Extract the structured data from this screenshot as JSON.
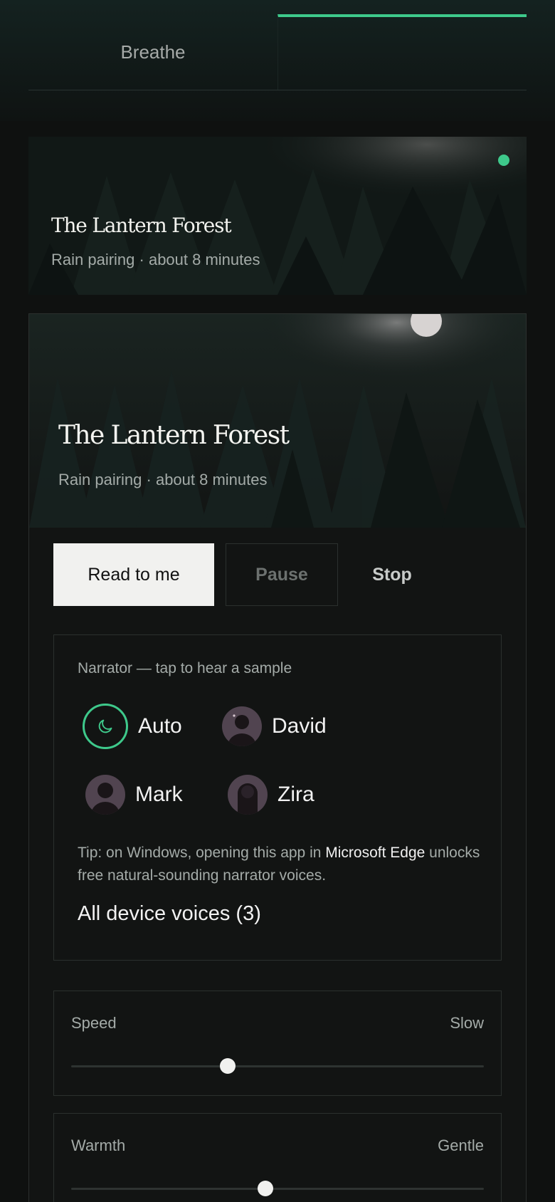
{
  "tabs": {
    "left_label": "Breathe"
  },
  "story": {
    "title": "The Lantern Forest",
    "subtitle": "Rain pairing · about 8 minutes"
  },
  "controls": {
    "read_label": "Read to me",
    "pause_label": "Pause",
    "stop_label": "Stop"
  },
  "narrator": {
    "label": "Narrator — tap to hear a sample",
    "voices": [
      {
        "name": "Auto",
        "icon": "moon-icon",
        "selected": true
      },
      {
        "name": "David",
        "icon": "avatar-icon",
        "selected": false
      },
      {
        "name": "Mark",
        "icon": "avatar-icon",
        "selected": false
      },
      {
        "name": "Zira",
        "icon": "avatar-icon",
        "selected": false
      }
    ],
    "tip_before": "Tip: on Windows, opening this app in ",
    "tip_highlight": "Microsoft Edge",
    "tip_after": " unlocks free natural-sounding narrator voices.",
    "all_voices": "All device voices (3)"
  },
  "sliders": {
    "speed": {
      "label": "Speed",
      "value": "Slow",
      "level": 0.38
    },
    "warmth": {
      "label": "Warmth",
      "value": "Gentle",
      "level": 0.47
    }
  },
  "colors": {
    "accent": "#3ec98b",
    "background": "#0f1110",
    "button": "#f1f1ef"
  }
}
